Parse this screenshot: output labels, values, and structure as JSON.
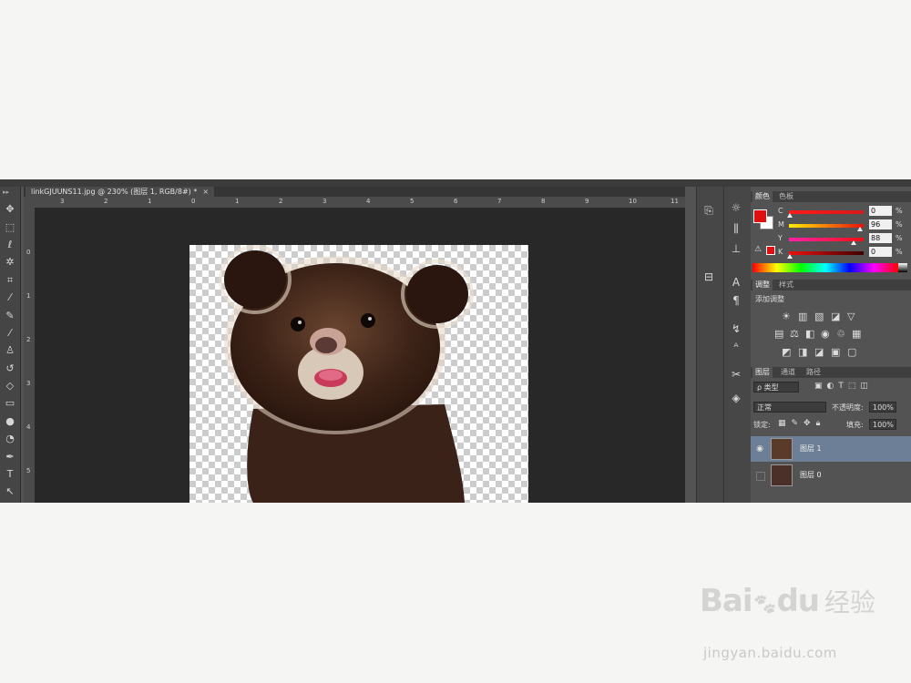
{
  "document": {
    "tab_title": "linkGJUUNS11.jpg @ 230% (图层 1, RGB/8#) *",
    "tab_close": "×"
  },
  "rulers": {
    "horizontal": [
      "3",
      "2",
      "1",
      "0",
      "1",
      "2",
      "3",
      "4",
      "5",
      "6",
      "7",
      "8",
      "9",
      "10",
      "11"
    ],
    "vertical": [
      "0",
      "1",
      "2",
      "3",
      "4",
      "5"
    ]
  },
  "panels": {
    "color": {
      "tabs": [
        "颜色",
        "色板"
      ],
      "foreground": "#e01010",
      "rows": [
        {
          "label": "C",
          "value": "0",
          "unit": "%",
          "level": 0.0,
          "gradient": "linear-gradient(to right,#ff1a1a,#d61a1a)"
        },
        {
          "label": "M",
          "value": "96",
          "unit": "%",
          "level": 0.96,
          "gradient": "linear-gradient(to right,#ffee00,#e81010)"
        },
        {
          "label": "Y",
          "value": "88",
          "unit": "%",
          "level": 0.88,
          "gradient": "linear-gradient(to right,#ff22aa,#ee1010)"
        },
        {
          "label": "K",
          "value": "0",
          "unit": "%",
          "level": 0.0,
          "gradient": "linear-gradient(to right,#ee1010,#400000)"
        }
      ]
    },
    "adjustments": {
      "tabs": [
        "调整",
        "样式"
      ],
      "add_label": "添加调整"
    },
    "layers": {
      "tabs": [
        "图层",
        "通道",
        "路径"
      ],
      "kind_filter": "ρ 类型",
      "blend_mode": "正常",
      "opacity_label": "不透明度:",
      "opacity_value": "100%",
      "lock_label": "锁定:",
      "fill_label": "填充:",
      "fill_value": "100%",
      "items": [
        {
          "name": "图层 1",
          "visible": true,
          "selected": true
        },
        {
          "name": "图层 0",
          "visible": false,
          "selected": false
        }
      ]
    }
  },
  "watermark": {
    "logo": "Bai",
    "logo2": "du",
    "cn": "经验",
    "url": "jingyan.baidu.com"
  },
  "colors": {
    "accent_red": "#e01010",
    "layer_selected": "#6c7f96"
  }
}
